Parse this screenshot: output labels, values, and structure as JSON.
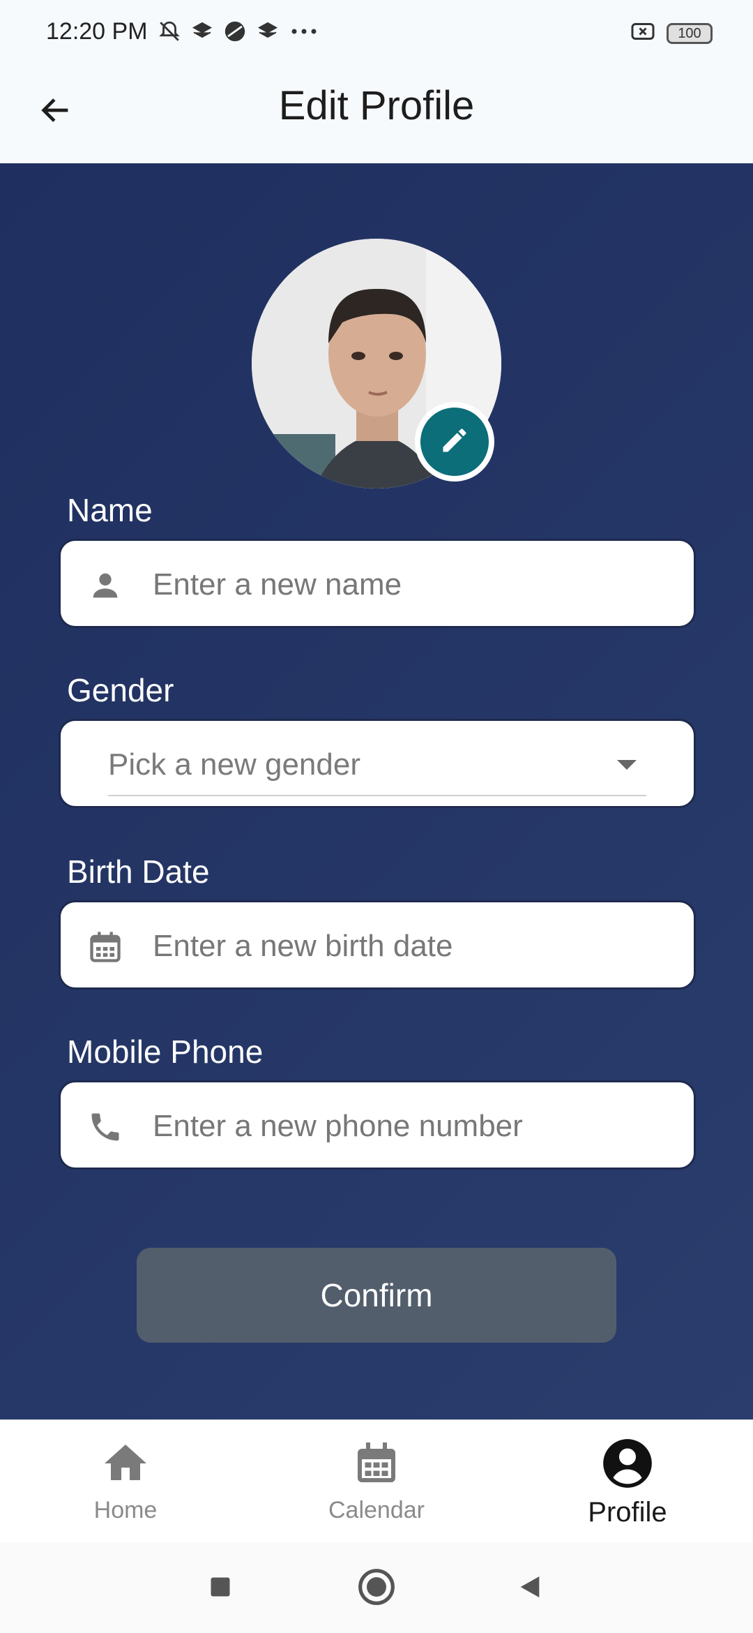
{
  "status": {
    "time": "12:20 PM",
    "battery": "100"
  },
  "header": {
    "title": "Edit Profile"
  },
  "form": {
    "name_label": "Name",
    "name_placeholder": "Enter a new name",
    "gender_label": "Gender",
    "gender_placeholder": "Pick a new gender",
    "birth_label": "Birth Date",
    "birth_placeholder": "Enter a new birth date",
    "phone_label": "Mobile Phone",
    "phone_placeholder": "Enter a new phone number",
    "confirm_label": "Confirm"
  },
  "nav": {
    "items": [
      {
        "label": "Home",
        "icon": "home-icon"
      },
      {
        "label": "Calendar",
        "icon": "calendar-icon"
      },
      {
        "label": "Profile",
        "icon": "account-circle-icon",
        "active": true
      }
    ]
  },
  "colors": {
    "background": "#24366a",
    "accent": "#0b6e78",
    "button": "#525e6c"
  }
}
